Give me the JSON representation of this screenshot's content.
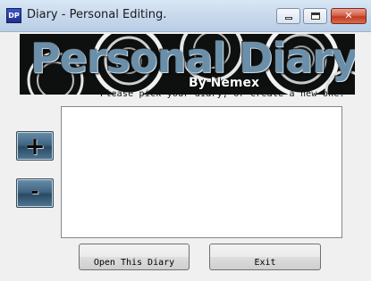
{
  "window": {
    "title": "Diary - Personal Editing.",
    "icon_text": "DP",
    "icon_name": "app-icon"
  },
  "banner": {
    "title": "Personal Diary",
    "subtitle": "By Nemex"
  },
  "instructions": "Please pick your diary, or create a new one.",
  "buttons": {
    "add_label": "+",
    "remove_label": "-",
    "open_label": "Open This Diary",
    "exit_label": "Exit"
  },
  "diary_list": {
    "items": []
  },
  "colors": {
    "banner_background": "#0e1010",
    "banner_title": "#6b8fa8",
    "side_button": "#3f6684",
    "close_button": "#c23a20"
  }
}
